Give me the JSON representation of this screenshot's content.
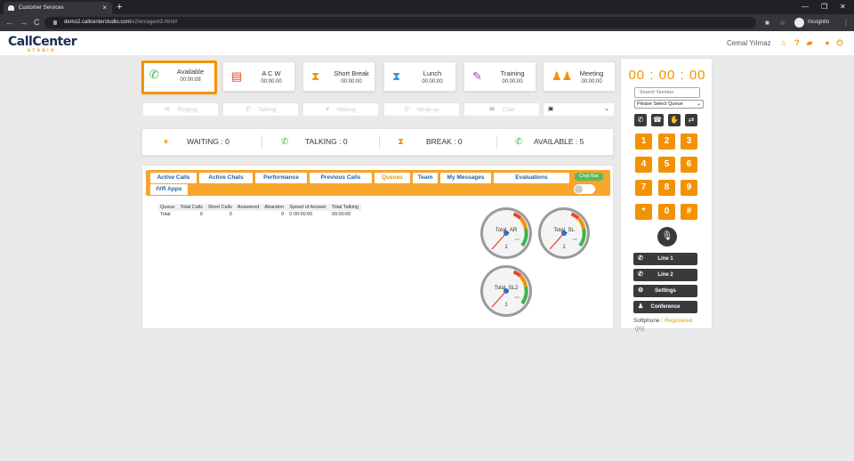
{
  "browser": {
    "tab_title": "Customer Services",
    "url_host": "demo2.callcenterstudio.com",
    "url_path": "/v2/en/agent3.html#",
    "incognito_label": "Incognito"
  },
  "app": {
    "logo_text": "CallCenter",
    "logo_sub": "STUDIO",
    "user_name": "Cemal Yılmaz"
  },
  "statuses": [
    {
      "label": "Available",
      "time": "00:00:08",
      "icon": "phone-icon",
      "color": "#3bb54a"
    },
    {
      "label": "A C W",
      "time": "00:00:00",
      "icon": "document-icon",
      "color": "#e8452c"
    },
    {
      "label": "Short Break",
      "time": "00:00:00",
      "icon": "hourglass-icon",
      "color": "#f39200"
    },
    {
      "label": "Lunch",
      "time": "00:00:00",
      "icon": "hourglass-icon",
      "color": "#2f8fd8"
    },
    {
      "label": "Training",
      "time": "00:00:00",
      "icon": "pencil-icon",
      "color": "#b03ec9"
    },
    {
      "label": "Meeting",
      "time": "00:00:00",
      "icon": "group-icon",
      "color": "#f39200"
    }
  ],
  "controls": {
    "ringing": "Ringing",
    "talking": "Talking",
    "waiting": "Waiting",
    "wrapup": "Wrap-up",
    "chat": "Chat"
  },
  "counters": {
    "waiting": "WAITING : 0",
    "talking": "TALKING : 0",
    "break": "BREAK : 0",
    "available": "AVAILABLE : 5"
  },
  "tabs": [
    "Active Calls",
    "Active Chats",
    "Performance",
    "Previous Calls",
    "Queues",
    "Team",
    "My Messages",
    "Evaluations",
    "IVR Apps"
  ],
  "selected_tab": "Queues",
  "chat_bar_label": "Chat Bar",
  "queue_table": {
    "headers": [
      "Queue",
      "Total Calls",
      "Short Calls",
      "Answered",
      "Abandon",
      "Speed of Answer",
      "Total Talking"
    ],
    "rows": [
      [
        "Total",
        "0",
        "0",
        "",
        "0",
        "0 00:00:00",
        "00:00:00"
      ]
    ]
  },
  "gauges": [
    {
      "label": "Total_AR",
      "value": "1",
      "max_label": "100"
    },
    {
      "label": "Total_SL",
      "value": "1",
      "max_label": "100"
    },
    {
      "label": "Total_SL2",
      "value": "1",
      "max_label": "100"
    }
  ],
  "softphone_panel": {
    "timer": "00 : 00 : 00",
    "search_placeholder": "Search Number",
    "queue_select": "Please Select Queue",
    "keypad": [
      "1",
      "2",
      "3",
      "4",
      "5",
      "6",
      "7",
      "8",
      "9",
      "*",
      "0",
      "#"
    ],
    "line1": "Line 1",
    "line2": "Line 2",
    "settings": "Settings",
    "conference": "Conference",
    "softphone_label": "Softphone :",
    "softphone_status": "Registered"
  }
}
